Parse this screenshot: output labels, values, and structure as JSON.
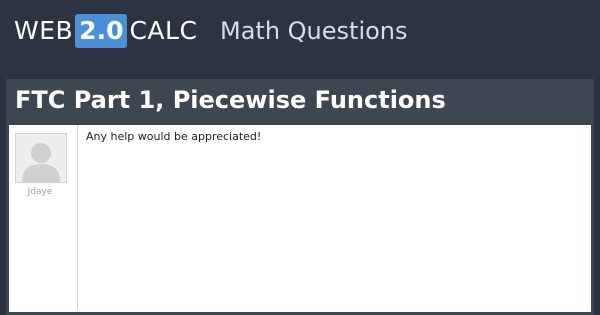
{
  "header": {
    "logo_prefix": "WEB",
    "logo_version": "2.0",
    "logo_suffix": "CALC",
    "section_title": "Math Questions"
  },
  "question": {
    "title": "FTC Part 1, Piecewise Functions"
  },
  "post": {
    "author": "Jdaye",
    "avatar_icon": "default-user-icon",
    "body": "Any help would be appreciated!"
  },
  "colors": {
    "background": "#2b3440",
    "panel": "#3d4752",
    "logo_badge": "#4a90d9"
  }
}
